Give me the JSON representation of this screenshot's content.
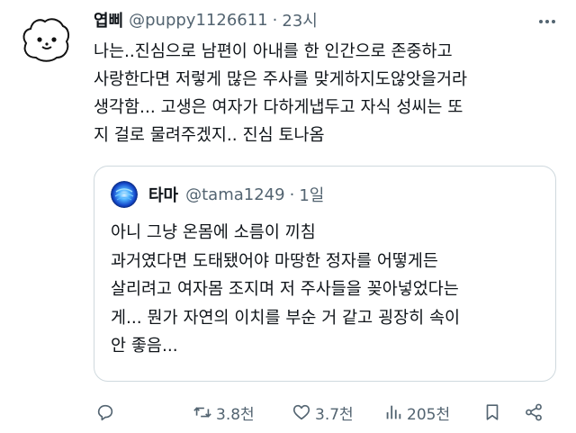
{
  "tweet": {
    "display_name": "엽삐",
    "handle": "@puppy1126611",
    "separator": "·",
    "time": "23시",
    "body": "나는..진심으로 남편이 아내를 한 인간으로 존중하고\n사랑한다면 저렇게 많은 주사를 맞게하지도않앗을거라\n생각함... 고생은 여자가 다하게냅두고 자식 성씨는 또\n지 걸로 물려주겠지.. 진심 토나옴"
  },
  "quote": {
    "display_name": "타마",
    "handle": "@tama1249",
    "separator": "·",
    "time": "1일",
    "body": "아니 그냥 온몸에 소름이 끼침\n과거였다면 도태됐어야 마땅한 정자를 어떻게든\n살리려고 여자몸 조지며 저 주사들을 꽂아넣었다는\n게... 뭔가 자연의 이치를 부순 거 같고 굉장히 속이\n안 좋음..."
  },
  "actions": {
    "reply_icon": "reply-icon",
    "retweet_count": "3.8천",
    "like_count": "3.7천",
    "view_count": "205천",
    "bookmark_icon": "bookmark-icon",
    "share_icon": "share-icon"
  },
  "colors": {
    "text": "#0f1419",
    "secondary": "#536471",
    "border": "#cfd9de"
  }
}
